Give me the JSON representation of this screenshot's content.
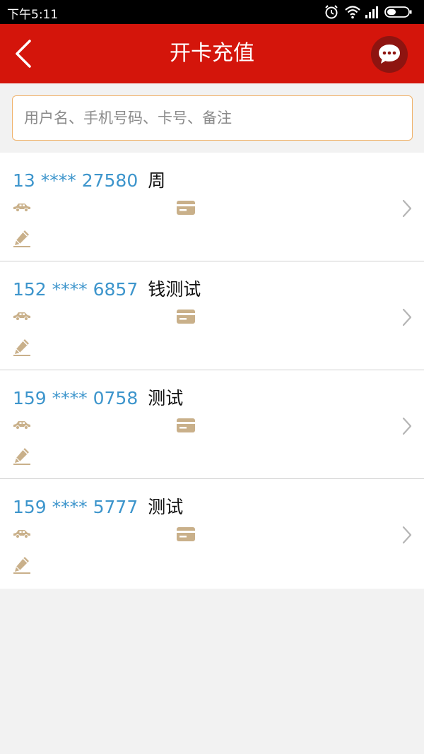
{
  "status_bar": {
    "time": "下午5:11",
    "icons": [
      "alarm-icon",
      "wifi-icon",
      "signal-icon",
      "battery-icon"
    ]
  },
  "header": {
    "title": "开卡充值",
    "left_icon": "back-chevron-icon",
    "right_icon": "chat-bubble-icon"
  },
  "search": {
    "placeholder": "用户名、手机号码、卡号、备注",
    "value": ""
  },
  "items": [
    {
      "number": "13 **** 27580",
      "name": "周"
    },
    {
      "number": "152 **** 6857",
      "name": "钱测试"
    },
    {
      "number": "159 **** 0758",
      "name": "测试"
    },
    {
      "number": "159 **** 5777",
      "name": "测试"
    }
  ],
  "colors": {
    "header_red": "#d4150b",
    "card_number_blue": "#3d95cc",
    "icon_tan": "#c9b08a",
    "search_border": "#f0b26a"
  }
}
